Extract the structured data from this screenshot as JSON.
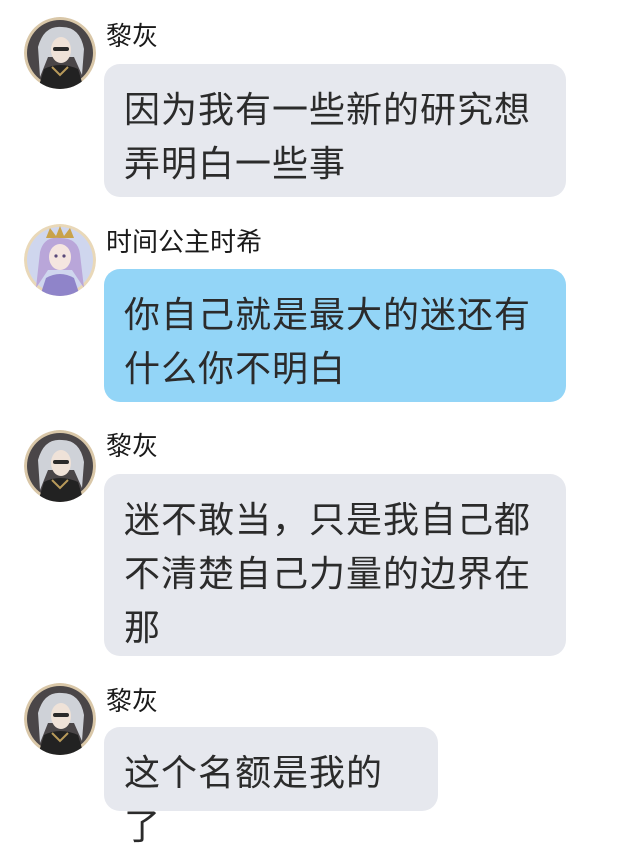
{
  "messages": [
    {
      "sender": "黎灰",
      "avatar_icon": "silver-haired-man-avatar",
      "bubble_color": "#e6e8ee",
      "text": "因为我有一些新的研究想弄明白一些事"
    },
    {
      "sender": "时间公主时希",
      "avatar_icon": "crowned-princess-avatar",
      "bubble_color": "#93d5f7",
      "text": "你自己就是最大的迷还有什么你不明白"
    },
    {
      "sender": "黎灰",
      "avatar_icon": "silver-haired-man-avatar",
      "bubble_color": "#e6e8ee",
      "text": "迷不敢当，只是我自己都不清楚自己力量的边界在那"
    },
    {
      "sender": "黎灰",
      "avatar_icon": "silver-haired-man-avatar",
      "bubble_color": "#e6e8ee",
      "text": "这个名额是我的了"
    }
  ]
}
